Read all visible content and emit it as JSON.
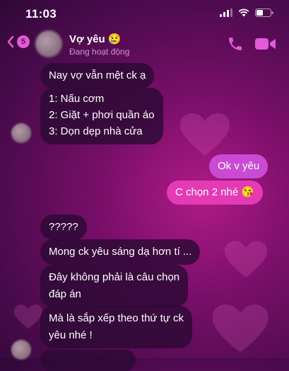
{
  "status_bar": {
    "time": "11:03"
  },
  "header": {
    "back_count": "5",
    "contact_name": "Vợ yêu 😢",
    "contact_status": "Đang hoạt động"
  },
  "messages": [
    {
      "side": "in",
      "lines": [
        "Nay vợ vẫn mệt ck ạ"
      ]
    },
    {
      "side": "in",
      "lines": [
        "1: Nấu cơm",
        "2: Giặt + phơi quần áo",
        "3: Dọn dẹp nhà cửa"
      ]
    },
    {
      "side": "out",
      "lines": [
        "Ok v yêu"
      ]
    },
    {
      "side": "out",
      "lines": [
        "C chọn 2 nhé 😘"
      ]
    },
    {
      "side": "in",
      "lines": [
        "?????"
      ]
    },
    {
      "side": "in",
      "lines": [
        "Mong ck yêu sáng dạ hơn tí ..."
      ]
    },
    {
      "side": "in",
      "lines": [
        "Đây không phải là câu chọn",
        "đáp án"
      ]
    },
    {
      "side": "in",
      "lines": [
        "Mà là sắp xếp theo thứ tự ck",
        "yêu nhé !"
      ]
    }
  ],
  "colors": {
    "accent": "#e25bd7",
    "outgoing_bubble": "#e43bb5",
    "incoming_bubble": "#2c0a34"
  }
}
